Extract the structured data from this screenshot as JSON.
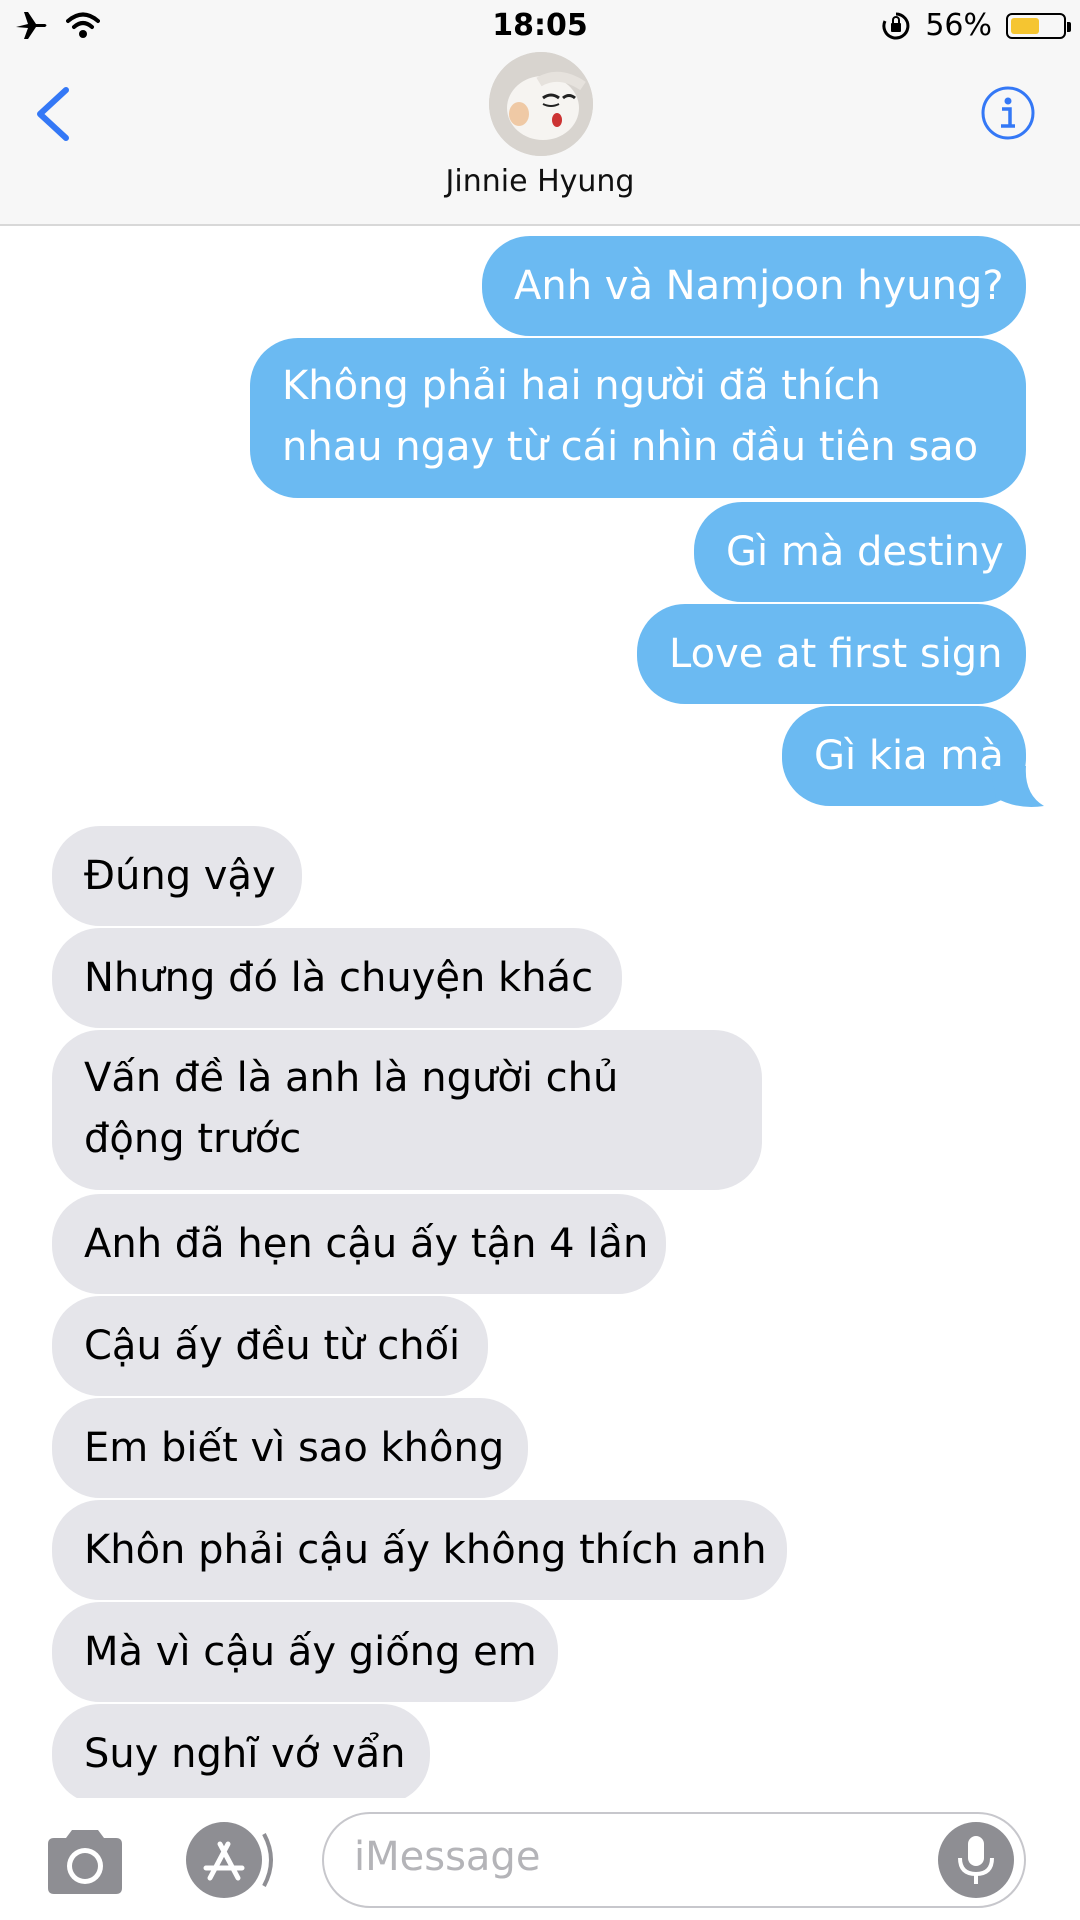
{
  "status_bar": {
    "time": "18:05",
    "battery_percent": "56%",
    "battery_level": 0.56,
    "icons": [
      "airplane-icon",
      "wifi-icon",
      "rotation-lock-icon",
      "battery-icon"
    ]
  },
  "header": {
    "contact_name": "Jinnie Hyung",
    "back_icon": "chevron-left-icon",
    "info_icon": "info-icon",
    "accent_color": "#3478f6"
  },
  "messages": [
    {
      "dir": "sent",
      "text": "Anh và Namjoon hyung?"
    },
    {
      "dir": "sent",
      "text": "Không phải hai người đã thích nhau ngay từ cái nhìn đầu tiên sao"
    },
    {
      "dir": "sent",
      "text": "Gì mà destiny"
    },
    {
      "dir": "sent",
      "text": "Love at first sign"
    },
    {
      "dir": "sent",
      "text": "Gì kia mà"
    },
    {
      "dir": "received",
      "text": "Đúng vậy"
    },
    {
      "dir": "received",
      "text": "Nhưng đó là chuyện khác"
    },
    {
      "dir": "received",
      "text": "Vấn đề là anh là người chủ động trước"
    },
    {
      "dir": "received",
      "text": "Anh đã hẹn cậu ấy tận 4 lần"
    },
    {
      "dir": "received",
      "text": "Cậu ấy đều từ chối"
    },
    {
      "dir": "received",
      "text": "Em biết vì sao không"
    },
    {
      "dir": "received",
      "text": "Khôn phải cậu ấy không thích anh"
    },
    {
      "dir": "received",
      "text": "Mà vì cậu ấy giống em"
    },
    {
      "dir": "received",
      "text": "Suy nghĩ vớ vẩn"
    }
  ],
  "input_bar": {
    "placeholder": "iMessage",
    "icons": [
      "camera-icon",
      "app-store-icon",
      "microphone-icon"
    ]
  },
  "colors": {
    "sent_bubble": "#6bbaf2",
    "received_bubble": "#e5e5ea",
    "header_bg": "#f7f7f7"
  }
}
